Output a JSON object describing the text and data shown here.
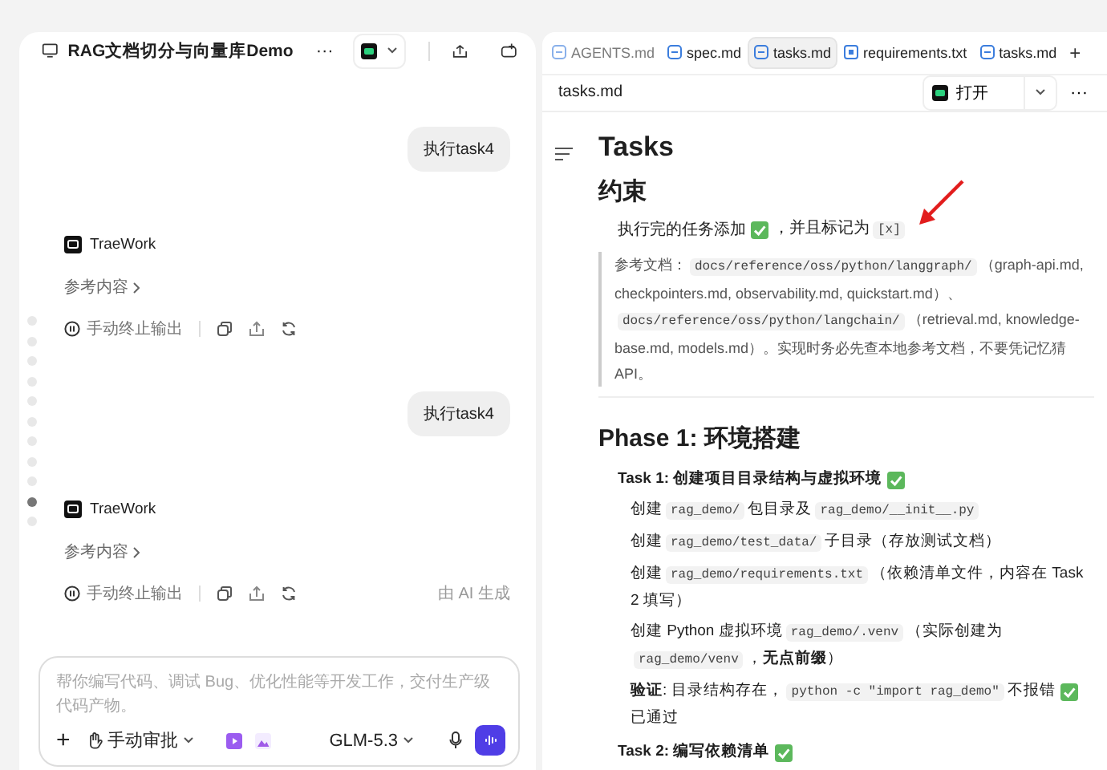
{
  "chat": {
    "title": "RAG文档切分与向量库Demo",
    "more": "···",
    "messages": [
      {
        "kind": "user",
        "text": "执行task4"
      },
      {
        "kind": "assistant",
        "agent": "TraeWork",
        "reference": "参考内容",
        "stop": "手动终止输出"
      },
      {
        "kind": "user",
        "text": "执行task4"
      },
      {
        "kind": "assistant",
        "agent": "TraeWork",
        "reference": "参考内容",
        "stop": "手动终止输出",
        "footnote": "由 AI 生成"
      }
    ],
    "nav_dots": [
      {
        "selected": false
      },
      {
        "selected": false
      },
      {
        "selected": false
      },
      {
        "selected": false
      },
      {
        "selected": false
      },
      {
        "selected": false
      },
      {
        "selected": false
      },
      {
        "selected": false
      },
      {
        "selected": false
      },
      {
        "selected": true
      },
      {
        "selected": false
      }
    ],
    "input": {
      "placeholder": "帮你编写代码、调试 Bug、优化性能等开发工作，交付生产级代码产物。",
      "add": "+",
      "approval": "手动审批",
      "model": "GLM-5.3"
    }
  },
  "doc": {
    "tabs": [
      {
        "label": "AGENTS.md",
        "kind": "md",
        "selected": false
      },
      {
        "label": "spec.md",
        "kind": "md",
        "selected": false
      },
      {
        "label": "tasks.md",
        "kind": "md",
        "selected": true
      },
      {
        "label": "requirements.txt",
        "kind": "txt",
        "selected": false
      },
      {
        "label": "tasks.md",
        "kind": "md",
        "selected": false
      }
    ],
    "new_tab": "+",
    "file": "tasks.md",
    "open": "打开",
    "more": "···",
    "blocks": [
      {
        "kind": "h1",
        "text": "Tasks"
      },
      {
        "kind": "h2",
        "text": "约束"
      },
      {
        "kind": "para",
        "segments": [
          {
            "kind": "text",
            "text": "执行完的任务添加"
          },
          {
            "kind": "check"
          },
          {
            "kind": "text",
            "text": "，并且标记为"
          },
          {
            "kind": "code",
            "text": "[x]"
          }
        ]
      },
      {
        "kind": "quote",
        "segments": [
          {
            "kind": "text",
            "text": "参考文档："
          },
          {
            "kind": "code",
            "text": "docs/reference/oss/python/langgraph/"
          },
          {
            "kind": "text",
            "text": "（graph-api.md, checkpointers.md, observability.md, quickstart.md）、"
          },
          {
            "kind": "code",
            "text": "docs/reference/oss/python/langchain/"
          },
          {
            "kind": "text",
            "text": "（retrieval.md, knowledge-base.md, models.md）。实现时务必先查本地参考文档，不要凭记忆猜 API。"
          }
        ]
      },
      {
        "kind": "rule"
      },
      {
        "kind": "h2",
        "text": "Phase 1: 环境搭建"
      },
      {
        "kind": "task",
        "segments": [
          {
            "kind": "text",
            "text": "Task 1: 创建项目目录结构与虚拟环境"
          },
          {
            "kind": "check"
          }
        ]
      },
      {
        "kind": "item",
        "segments": [
          {
            "kind": "text",
            "text": "创建"
          },
          {
            "kind": "code",
            "text": "rag_demo/"
          },
          {
            "kind": "text",
            "text": "包目录及"
          },
          {
            "kind": "code",
            "text": "rag_demo/__init__.py"
          }
        ]
      },
      {
        "kind": "item",
        "segments": [
          {
            "kind": "text",
            "text": "创建"
          },
          {
            "kind": "code",
            "text": "rag_demo/test_data/"
          },
          {
            "kind": "text",
            "text": "子目录（存放测试文档）"
          }
        ]
      },
      {
        "kind": "item",
        "segments": [
          {
            "kind": "text",
            "text": "创建"
          },
          {
            "kind": "code",
            "text": "rag_demo/requirements.txt"
          },
          {
            "kind": "text",
            "text": "（依赖清单文件，内容在 Task 2 填写）"
          }
        ]
      },
      {
        "kind": "item",
        "segments": [
          {
            "kind": "text",
            "text": "创建 Python 虚拟环境"
          },
          {
            "kind": "code",
            "text": "rag_demo/.venv"
          },
          {
            "kind": "text",
            "text": "（实际创建为"
          },
          {
            "kind": "code",
            "text": "rag_demo/venv"
          },
          {
            "kind": "text",
            "text": "，**无点前缀**）"
          }
        ]
      },
      {
        "kind": "item",
        "segments": [
          {
            "kind": "text",
            "text": "**验证**: 目录结构存在，"
          },
          {
            "kind": "code",
            "text": "python -c \"import rag_demo\""
          },
          {
            "kind": "text",
            "text": "不报错"
          },
          {
            "kind": "check"
          },
          {
            "kind": "text",
            "text": "已通过"
          }
        ]
      },
      {
        "kind": "task",
        "segments": [
          {
            "kind": "text",
            "text": "Task 2: 编写依赖清单"
          },
          {
            "kind": "check"
          }
        ]
      }
    ]
  }
}
